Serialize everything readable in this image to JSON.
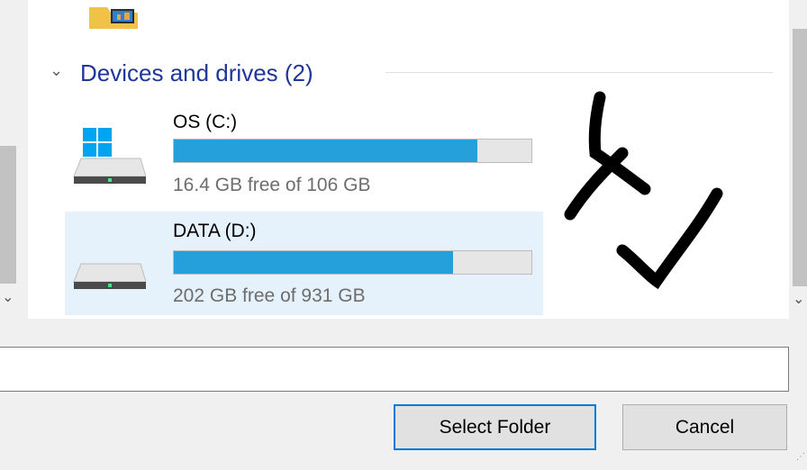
{
  "group": {
    "title": "Devices and drives (2)"
  },
  "drives": [
    {
      "name": "OS (C:)",
      "free_text": "16.4 GB free of 106 GB",
      "used_fraction": 0.85,
      "icon": "windows-drive-icon",
      "selected": false
    },
    {
      "name": "DATA (D:)",
      "free_text": "202 GB free of 931 GB",
      "used_fraction": 0.78,
      "icon": "hard-drive-icon",
      "selected": true
    }
  ],
  "footer": {
    "folder_input_value": "",
    "select_folder_label": "Select Folder",
    "cancel_label": "Cancel"
  },
  "colors": {
    "accent": "#26a0da",
    "group_title": "#1e3799",
    "selection_bg": "#e5f1fb",
    "focus_border": "#0078d7"
  }
}
